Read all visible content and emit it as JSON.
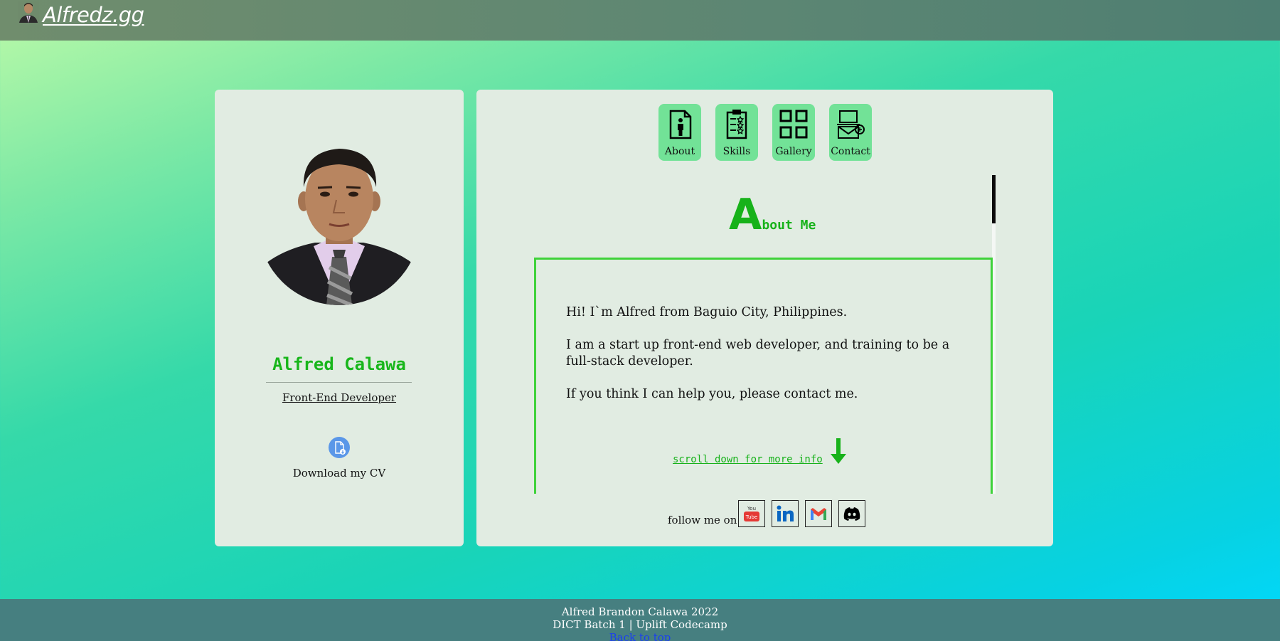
{
  "header": {
    "logo_text": "Alfredz.gg",
    "logo_icon": "profile-thumbnail"
  },
  "profile": {
    "name": "Alfred Calawa",
    "role": "Front-End Developer",
    "photo": "profile-photo",
    "cv_icon": "download-file-icon",
    "cv_label": "Download my CV"
  },
  "nav": [
    {
      "label": "About",
      "icon": "person-document-icon"
    },
    {
      "label": "Skills",
      "icon": "clipboard-stars-icon"
    },
    {
      "label": "Gallery",
      "icon": "grid-icon"
    },
    {
      "label": "Contact",
      "icon": "laptop-mail-icon"
    }
  ],
  "about": {
    "title_initial": "A",
    "title_rest": "bout Me",
    "paragraphs": [
      "Hi! I`m Alfred from Baguio City, Philippines.",
      "I am a start up front-end web developer, and training to be a full-stack developer.",
      "If you think I can help you, please contact me."
    ],
    "scroll_hint": "scroll down for more info"
  },
  "social": {
    "label": "follow me on",
    "links": [
      "youtube-icon",
      "linkedin-icon",
      "gmail-icon",
      "discord-icon"
    ]
  },
  "footer": {
    "line1": "Alfred Brandon Calawa 2022",
    "line2": "DICT Batch 1 | Uplift Codecamp",
    "back_to_top": "Back to top"
  },
  "colors": {
    "accent_green": "#17b21a",
    "card_bg": "#e1ece2",
    "nav_btn_bg": "#72e297",
    "footer_bg": "#467f80",
    "header_bg": "#5c8673"
  }
}
